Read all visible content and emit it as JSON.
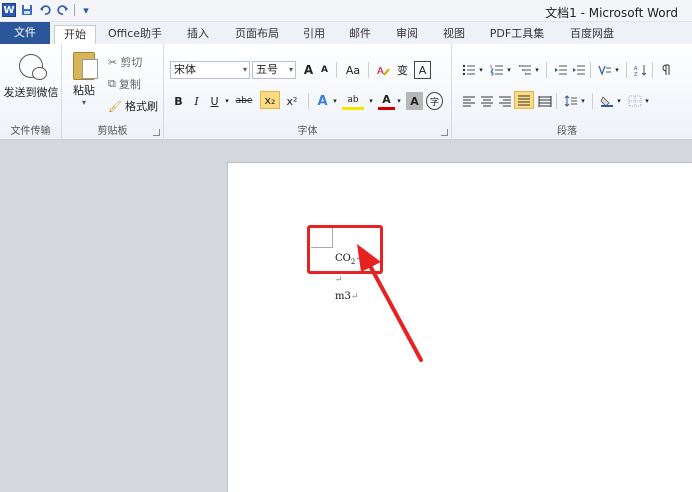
{
  "window": {
    "title": "文档1 - Microsoft Word"
  },
  "qat": {
    "logo": "W",
    "save_icon": "save-icon",
    "undo_icon": "undo-icon",
    "redo_icon": "redo-icon",
    "customize": "▾"
  },
  "tabs": [
    {
      "label": "文件"
    },
    {
      "label": "开始"
    },
    {
      "label": "Office助手"
    },
    {
      "label": "插入"
    },
    {
      "label": "页面布局"
    },
    {
      "label": "引用"
    },
    {
      "label": "邮件"
    },
    {
      "label": "审阅"
    },
    {
      "label": "视图"
    },
    {
      "label": "PDF工具集"
    },
    {
      "label": "百度网盘"
    }
  ],
  "ribbon": {
    "file_transfer": {
      "button": "发送到微信",
      "group": "文件传输"
    },
    "clipboard": {
      "paste": "粘贴",
      "cut": "剪切",
      "copy": "复制",
      "format_painter": "格式刷",
      "group": "剪贴板"
    },
    "font": {
      "font_name": "宋体",
      "font_size": "五号",
      "grow": "A",
      "shrink": "A",
      "case": "Aa",
      "phonetic": "变",
      "border_char": "A",
      "bold": "B",
      "italic": "I",
      "underline": "U",
      "strike": "abe",
      "subscript": "x₂",
      "superscript": "x²",
      "effects": "A",
      "highlight": "ab",
      "font_color": "A",
      "shading": "A",
      "enclose": "字",
      "group": "字体"
    },
    "paragraph": {
      "group": "段落"
    }
  },
  "document": {
    "line1": "CO",
    "line1_sub": "2",
    "line2": "m3"
  },
  "colors": {
    "file_tab": "#2b579a",
    "annotation": "#e62222",
    "subscript_active": "#fbdc85"
  }
}
